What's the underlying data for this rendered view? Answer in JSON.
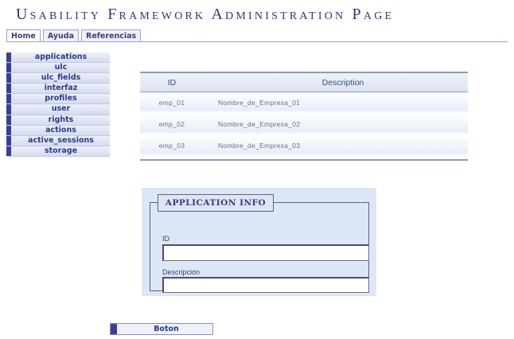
{
  "header": {
    "title": "Usability Framework Administration Page"
  },
  "tabs": [
    {
      "label": "Home",
      "active": true
    },
    {
      "label": "Ayuda",
      "active": false
    },
    {
      "label": "Referencias",
      "active": false
    }
  ],
  "sidebar": {
    "items": [
      {
        "label": "applications"
      },
      {
        "label": "ulc"
      },
      {
        "label": "ulc_fields"
      },
      {
        "label": "interfaz"
      },
      {
        "label": "profiles"
      },
      {
        "label": "user"
      },
      {
        "label": "rights"
      },
      {
        "label": "actions"
      },
      {
        "label": "active_sessions"
      },
      {
        "label": "storage"
      }
    ]
  },
  "grid": {
    "columns": [
      "ID",
      "Description"
    ],
    "rows": [
      {
        "id": "emp_01",
        "description": "Nombre_de_Empresa_01"
      },
      {
        "id": "emp_02",
        "description": "Nombre_de_Empresa_02"
      },
      {
        "id": "emp_03",
        "description": "Nombre_de_Empresa_03"
      }
    ]
  },
  "info_panel": {
    "legend": "APPLICATION INFO",
    "id_label": "ID",
    "id_value": "",
    "desc_label": "Descripcion",
    "desc_value": ""
  },
  "actions": {
    "boton_label": "Boton"
  },
  "colors": {
    "accent": "#3a3e9a",
    "text": "#2a3a8a",
    "panel": "#dde6f4"
  }
}
